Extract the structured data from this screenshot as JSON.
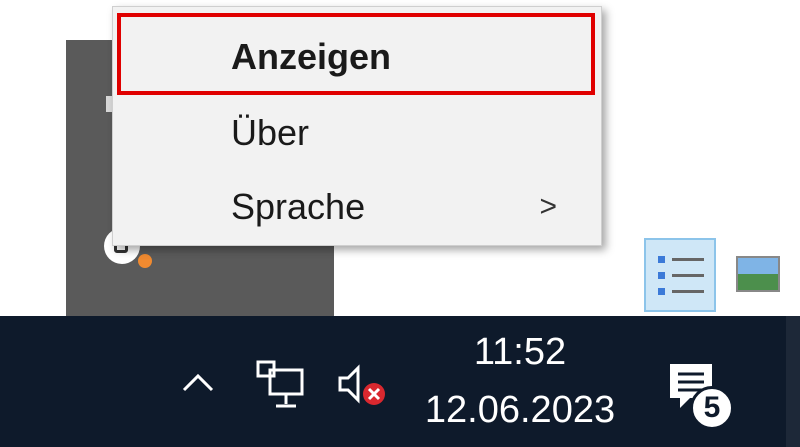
{
  "context_menu": {
    "items": [
      {
        "label": "Anzeigen",
        "bold": true,
        "highlighted": true
      },
      {
        "label": "Über"
      },
      {
        "label": "Sprache",
        "has_submenu": true,
        "submenu_arrow": ">"
      }
    ],
    "highlight_color": "#e00000"
  },
  "taskbar": {
    "background": "#0e1a2b",
    "tray_icons": [
      "chevron-up-icon",
      "network-icon",
      "volume-muted-icon"
    ],
    "clock": {
      "time": "11:52",
      "date": "12.06.2023"
    },
    "notifications": {
      "icon": "notification-center-icon",
      "count": "5"
    }
  },
  "view_toggles": [
    "details-view-icon",
    "image-view-icon"
  ]
}
